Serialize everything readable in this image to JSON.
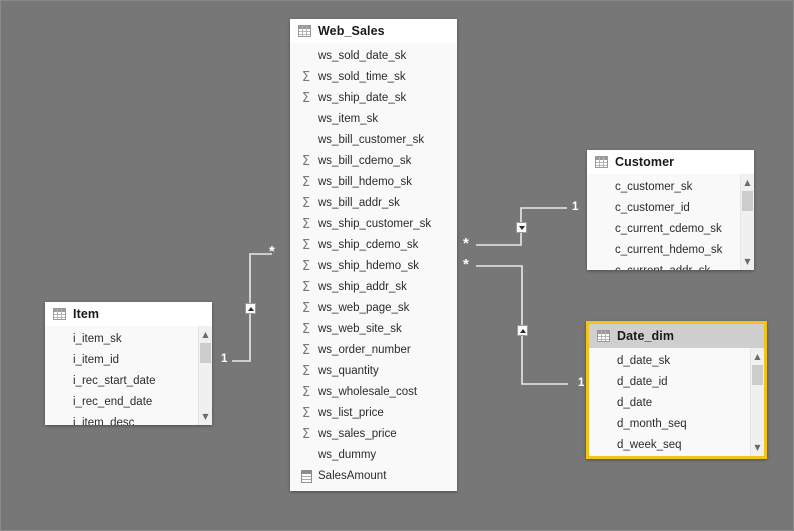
{
  "canvas": {
    "background": "#777777",
    "selection_color": "#f2c31a"
  },
  "icons": {
    "table": "table-grid-icon",
    "summation": "sigma-summation-icon",
    "measure": "calculator-measure-icon",
    "scroll_up": "chevron-up-icon",
    "scroll_down": "chevron-down-icon"
  },
  "tables": [
    {
      "id": "web_sales",
      "name": "Web_Sales",
      "selected": false,
      "has_scrollbar": false,
      "fields": [
        {
          "name": "ws_sold_date_sk",
          "icon": "none"
        },
        {
          "name": "ws_sold_time_sk",
          "icon": "sigma"
        },
        {
          "name": "ws_ship_date_sk",
          "icon": "sigma"
        },
        {
          "name": "ws_item_sk",
          "icon": "none"
        },
        {
          "name": "ws_bill_customer_sk",
          "icon": "none"
        },
        {
          "name": "ws_bill_cdemo_sk",
          "icon": "sigma"
        },
        {
          "name": "ws_bill_hdemo_sk",
          "icon": "sigma"
        },
        {
          "name": "ws_bill_addr_sk",
          "icon": "sigma"
        },
        {
          "name": "ws_ship_customer_sk",
          "icon": "sigma"
        },
        {
          "name": "ws_ship_cdemo_sk",
          "icon": "sigma"
        },
        {
          "name": "ws_ship_hdemo_sk",
          "icon": "sigma"
        },
        {
          "name": "ws_ship_addr_sk",
          "icon": "sigma"
        },
        {
          "name": "ws_web_page_sk",
          "icon": "sigma"
        },
        {
          "name": "ws_web_site_sk",
          "icon": "sigma"
        },
        {
          "name": "ws_order_number",
          "icon": "sigma"
        },
        {
          "name": "ws_quantity",
          "icon": "sigma"
        },
        {
          "name": "ws_wholesale_cost",
          "icon": "sigma"
        },
        {
          "name": "ws_list_price",
          "icon": "sigma"
        },
        {
          "name": "ws_sales_price",
          "icon": "sigma"
        },
        {
          "name": "ws_dummy",
          "icon": "none"
        },
        {
          "name": "SalesAmount",
          "icon": "measure"
        }
      ]
    },
    {
      "id": "item",
      "name": "Item",
      "selected": false,
      "has_scrollbar": true,
      "fields": [
        {
          "name": "i_item_sk",
          "icon": "none"
        },
        {
          "name": "i_item_id",
          "icon": "none"
        },
        {
          "name": "i_rec_start_date",
          "icon": "none"
        },
        {
          "name": "i_rec_end_date",
          "icon": "none"
        },
        {
          "name": "i_item_desc",
          "icon": "none"
        }
      ]
    },
    {
      "id": "customer",
      "name": "Customer",
      "selected": false,
      "has_scrollbar": true,
      "fields": [
        {
          "name": "c_customer_sk",
          "icon": "none"
        },
        {
          "name": "c_customer_id",
          "icon": "none"
        },
        {
          "name": "c_current_cdemo_sk",
          "icon": "none"
        },
        {
          "name": "c_current_hdemo_sk",
          "icon": "none"
        },
        {
          "name": "c_current_addr_sk",
          "icon": "none"
        }
      ]
    },
    {
      "id": "date_dim",
      "name": "Date_dim",
      "selected": true,
      "has_scrollbar": true,
      "fields": [
        {
          "name": "d_date_sk",
          "icon": "none"
        },
        {
          "name": "d_date_id",
          "icon": "none"
        },
        {
          "name": "d_date",
          "icon": "none"
        },
        {
          "name": "d_month_seq",
          "icon": "none"
        },
        {
          "name": "d_week_seq",
          "icon": "none"
        }
      ]
    }
  ],
  "relationships": [
    {
      "id": "item-to-web_sales",
      "from_table": "Item",
      "to_table": "Web_Sales",
      "from_cardinality": "1",
      "to_cardinality": "*",
      "cross_filter": "single-up"
    },
    {
      "id": "web_sales-to-customer",
      "from_table": "Web_Sales",
      "to_table": "Customer",
      "from_cardinality": "*",
      "to_cardinality": "1",
      "cross_filter": "single-down"
    },
    {
      "id": "web_sales-to-date_dim",
      "from_table": "Web_Sales",
      "to_table": "Date_dim",
      "from_cardinality": "*",
      "to_cardinality": "1",
      "cross_filter": "single-up"
    }
  ]
}
